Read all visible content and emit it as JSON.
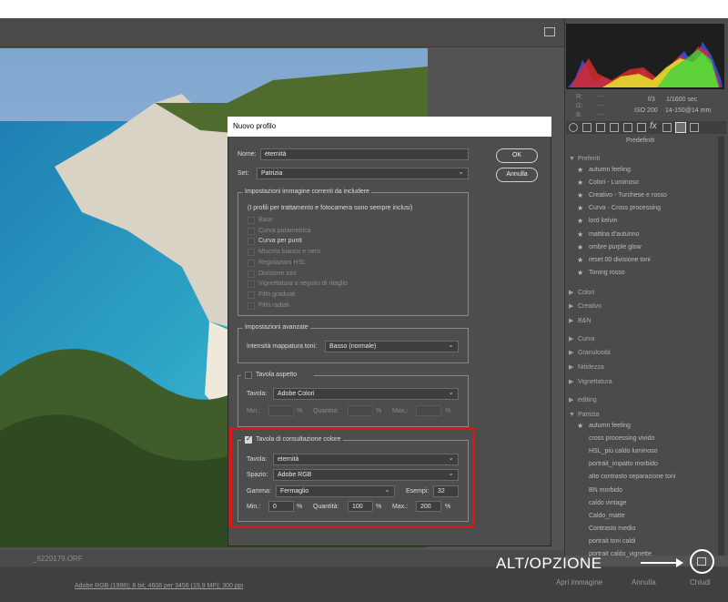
{
  "preset_panel": {
    "title": "Predefiniti",
    "exif": {
      "r": "R:",
      "g": "G:",
      "b": "B:",
      "r_val": "---",
      "g_val": "---",
      "b_val": "---",
      "aperture": "f/3",
      "shutter": "1/1600 sec",
      "iso": "ISO 200",
      "lens": "14-150@14 mm"
    },
    "favorites_label": "Preferiti",
    "favorites": [
      "autumn feeling",
      "Colori - Luminoso",
      "Creativo - Turchese e rosso",
      "Curva - Cross processing",
      "lord kelvin",
      "mattina d'autunno",
      "ombre purple glow",
      "reset 00 divisione toni",
      "Toning rosso"
    ],
    "groups": [
      "Colori",
      "Creativo",
      "B&N",
      "Curva",
      "Granulosità",
      "Nitidezza",
      "Vignettatura",
      "editing",
      "Patrizia"
    ],
    "patrizia_items": [
      "autumn feeling",
      "cross processing vivido",
      "HSL_più caldo luminoso",
      "portrait_impatto morbido",
      "alto contrasto separazione toni",
      "BN morbido",
      "caldo vintage",
      "Caldo_matte",
      "Contrasto medio",
      "portrait toni caldi",
      "portrait caldo_vignette"
    ]
  },
  "status": {
    "filename": "_6220179.ORF",
    "info": "Adobe RGB (1998); 8 bit; 4608 per 3456 (15,9 MP); 300 ppi"
  },
  "bottom": {
    "open_label": "Apri immagine",
    "cancel_label": "Annulla",
    "close_label": "Chiudi"
  },
  "annotation": {
    "text": "ALT/OPZIONE"
  },
  "dialog": {
    "title": "Nuovo profilo",
    "name_label": "Nome:",
    "name_value": "eternità",
    "set_label": "Set:",
    "set_value": "Patrizia",
    "ok_label": "OK",
    "cancel_label": "Annulla",
    "settings_header": "Impostazioni immagine correnti da includere",
    "settings_note": "(I profili per trattamento e fotocamera sono sempre inclusi)",
    "settings_items": [
      "Base",
      "Curva parametrica",
      "Curva per punti",
      "Miscela bianco e nero",
      "Regolazioni HSL",
      "Divisione toni",
      "Vignettatura a seguito di ritaglio",
      "Filtri graduati",
      "Filtri radiali"
    ],
    "advanced_header": "Impostazioni avanzate",
    "tone_label": "Intensità mappatura toni:",
    "tone_value": "Basso (normale)",
    "look_header": "Tavola aspetto",
    "look_table_label": "Tavola:",
    "look_table_value": "Adobe Colori",
    "look_min": "Min.:",
    "look_amount": "Quantità:",
    "look_max": "Max.:",
    "pct": "%",
    "lut_header": "Tavola di consultazione colore",
    "lut_table_label": "Tavola:",
    "lut_table_value": "eternità",
    "space_label": "Spazio:",
    "space_value": "Adobe RGB",
    "gamma_label": "Gamma:",
    "gamma_value": "Fermaglio",
    "samples_label": "Esempi:",
    "samples_value": "32",
    "min_label": "Min.:",
    "min_value": "0",
    "amount_label": "Quantità:",
    "amount_value": "100",
    "max_label": "Max.:",
    "max_value": "200"
  }
}
